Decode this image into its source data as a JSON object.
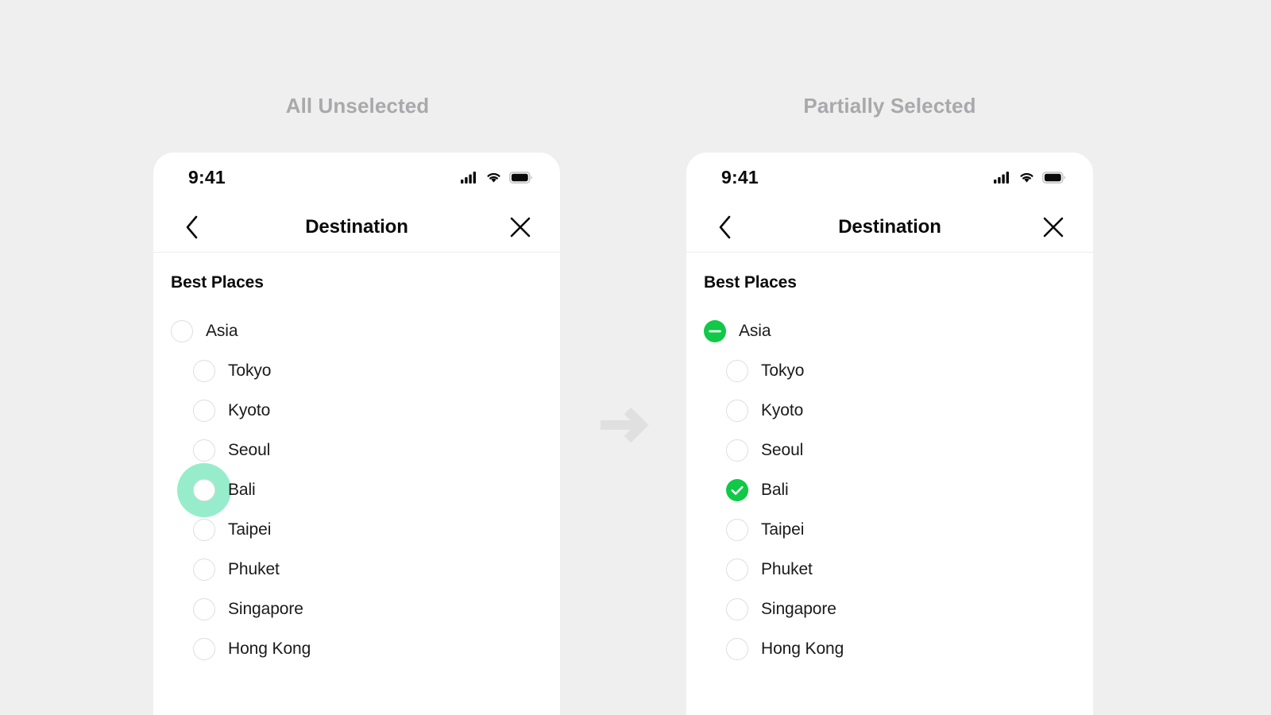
{
  "page": {
    "background_color": "#EFEFF0",
    "accent_green": "#0FC947",
    "ripple_color": "rgba(24, 214, 140, 0.45)",
    "unchecked_border": "#DEDEE0",
    "caption_color": "#A9A9AB",
    "arrow_color": "#E0E0E0"
  },
  "panels": [
    {
      "caption": "All Unselected",
      "status_bar": {
        "time": "9:41",
        "icons": [
          "signal-icon",
          "wifi-icon",
          "battery-icon"
        ]
      },
      "nav": {
        "back_label": "back-chevron-icon",
        "title": "Destination",
        "close_label": "close-icon"
      },
      "section_title": "Best Places",
      "items": [
        {
          "label": "Asia",
          "level": 0,
          "state": "unchecked",
          "ripple": false
        },
        {
          "label": "Tokyo",
          "level": 1,
          "state": "unchecked",
          "ripple": false
        },
        {
          "label": "Kyoto",
          "level": 1,
          "state": "unchecked",
          "ripple": false
        },
        {
          "label": "Seoul",
          "level": 1,
          "state": "unchecked",
          "ripple": false
        },
        {
          "label": "Bali",
          "level": 1,
          "state": "unchecked",
          "ripple": true
        },
        {
          "label": "Taipei",
          "level": 1,
          "state": "unchecked",
          "ripple": false
        },
        {
          "label": "Phuket",
          "level": 1,
          "state": "unchecked",
          "ripple": false
        },
        {
          "label": "Singapore",
          "level": 1,
          "state": "unchecked",
          "ripple": false
        },
        {
          "label": "Hong Kong",
          "level": 1,
          "state": "unchecked",
          "ripple": false
        }
      ]
    },
    {
      "caption": "Partially Selected",
      "status_bar": {
        "time": "9:41",
        "icons": [
          "signal-icon",
          "wifi-icon",
          "battery-icon"
        ]
      },
      "nav": {
        "back_label": "back-chevron-icon",
        "title": "Destination",
        "close_label": "close-icon"
      },
      "section_title": "Best Places",
      "items": [
        {
          "label": "Asia",
          "level": 0,
          "state": "indeterminate",
          "ripple": false
        },
        {
          "label": "Tokyo",
          "level": 1,
          "state": "unchecked",
          "ripple": false
        },
        {
          "label": "Kyoto",
          "level": 1,
          "state": "unchecked",
          "ripple": false
        },
        {
          "label": "Seoul",
          "level": 1,
          "state": "unchecked",
          "ripple": false
        },
        {
          "label": "Bali",
          "level": 1,
          "state": "checked",
          "ripple": false
        },
        {
          "label": "Taipei",
          "level": 1,
          "state": "unchecked",
          "ripple": false
        },
        {
          "label": "Phuket",
          "level": 1,
          "state": "unchecked",
          "ripple": false
        },
        {
          "label": "Singapore",
          "level": 1,
          "state": "unchecked",
          "ripple": false
        },
        {
          "label": "Hong Kong",
          "level": 1,
          "state": "unchecked",
          "ripple": false
        }
      ]
    }
  ],
  "transition": {
    "icon": "arrow-right-icon"
  }
}
